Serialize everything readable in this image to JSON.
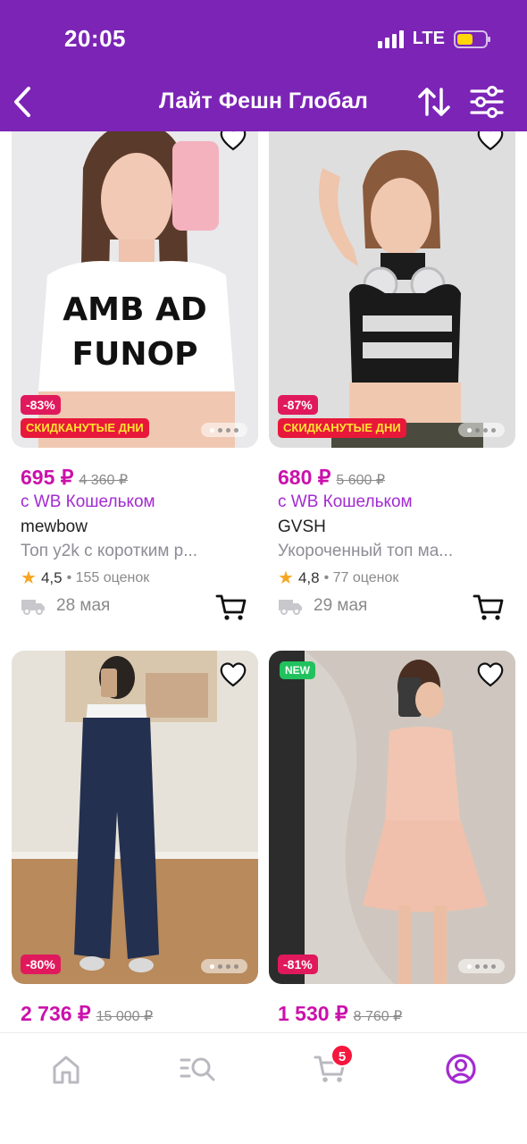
{
  "status_bar": {
    "time": "20:05",
    "network": "LTE"
  },
  "header": {
    "title": "Лайт Фешн Глобал"
  },
  "icons": {
    "back": "chevron-left-icon",
    "sort": "sort-arrows-icon",
    "filter": "sliders-icon",
    "favorite": "heart-icon",
    "cart": "cart-icon",
    "delivery": "truck-icon"
  },
  "colors": {
    "header_bg": "#7b24b6",
    "price": "#cb11ab",
    "wallet_text": "#a32bd0",
    "discount_badge": "#e0195c",
    "sale_badge_bg": "#e8183a",
    "sale_badge_text": "#ffe42e",
    "new_badge": "#21c25e",
    "rating_star": "#f5a623",
    "active_nav": "#a32bd0"
  },
  "products": [
    {
      "discount": "-83%",
      "promo": "СКИДКАНУТЫЕ ДНИ",
      "price": "695 ₽",
      "old_price": "4 360 ₽",
      "wallet": "с WB Кошельком",
      "brand": "mewbow",
      "name": "Топ y2k с коротким р...",
      "rating": "4,5",
      "reviews": "• 155 оценок",
      "delivery": "28 мая"
    },
    {
      "discount": "-87%",
      "promo": "СКИДКАНУТЫЕ ДНИ",
      "price": "680 ₽",
      "old_price": "5 600 ₽",
      "wallet": "с WB Кошельком",
      "brand": "GVSH",
      "name": "Укороченный топ ма...",
      "rating": "4,8",
      "reviews": "• 77 оценок",
      "delivery": "29 мая"
    },
    {
      "discount": "-80%",
      "price": "2 736 ₽",
      "old_price": "15 000 ₽"
    },
    {
      "badge": "NEW",
      "discount": "-81%",
      "price": "1 530 ₽",
      "old_price": "8 760 ₽"
    }
  ],
  "bottom_nav": {
    "items": [
      "home-icon",
      "catalog-search-icon",
      "cart-icon",
      "profile-icon"
    ],
    "cart_count": "5",
    "active": "profile"
  }
}
